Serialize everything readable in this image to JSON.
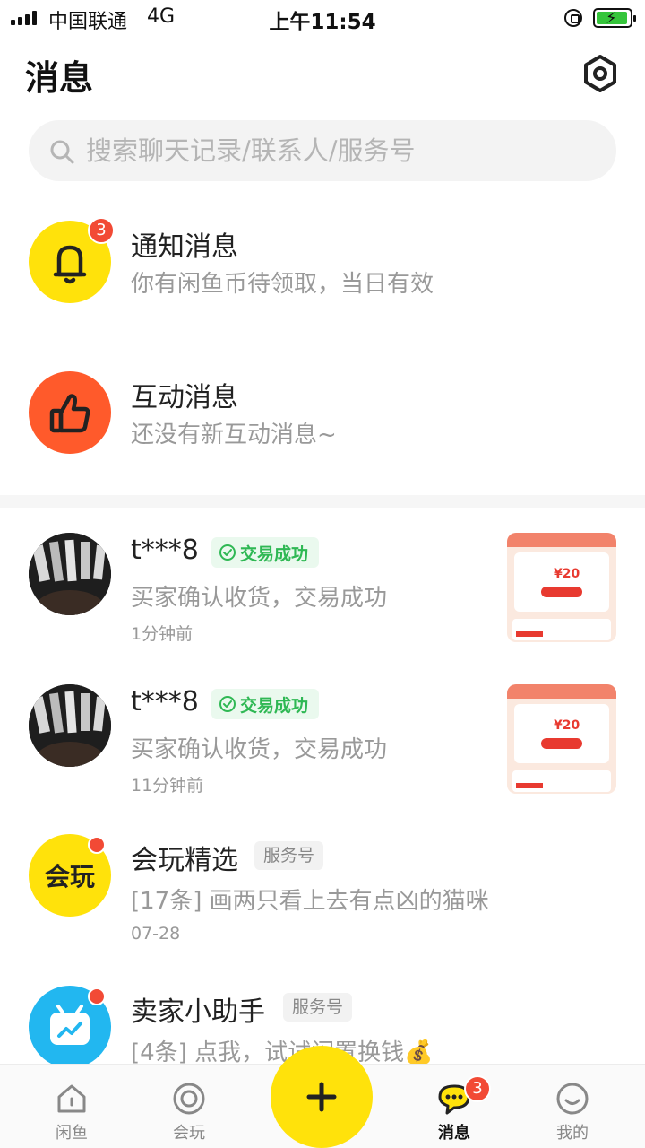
{
  "status_bar": {
    "carrier": "中国联通",
    "network": "4G",
    "time": "上午11:54",
    "battery_icon": "battery-charging-icon"
  },
  "header": {
    "title": "消息",
    "settings_icon": "settings-hexagon-icon"
  },
  "search": {
    "placeholder": "搜索聊天记录/联系人/服务号"
  },
  "system_rows": [
    {
      "title": "通知消息",
      "subtitle": "你有闲鱼币待领取，当日有效",
      "badge": "3",
      "icon": "bell-icon",
      "color": "#ffe20b"
    },
    {
      "title": "互动消息",
      "subtitle": "还没有新互动消息~",
      "icon": "thumbs-up-icon",
      "color": "#ff5a2b"
    }
  ],
  "conversations": [
    {
      "name": "t***8",
      "tag": "交易成功",
      "message": "买家确认收货，交易成功",
      "time": "1分钟前",
      "thumb_price": "¥20"
    },
    {
      "name": "t***8",
      "tag": "交易成功",
      "message": "买家确认收货，交易成功",
      "time": "11分钟前",
      "thumb_price": "¥20"
    },
    {
      "name": "会玩精选",
      "tag": "服务号",
      "message": "[17条] 画两只看上去有点凶的猫咪",
      "time": "07-28",
      "avatar_text": "会玩"
    },
    {
      "name": "卖家小助手",
      "tag": "服务号",
      "message": "[4条] 点我，试试闲置换钱💰"
    }
  ],
  "tabbar": {
    "tabs": [
      {
        "label": "闲鱼",
        "icon": "home-icon"
      },
      {
        "label": "会玩",
        "icon": "circle-icon"
      },
      {
        "label": "消息",
        "icon": "chat-icon",
        "badge": "3"
      },
      {
        "label": "我的",
        "icon": "smiley-icon"
      }
    ],
    "fab_icon": "plus-icon"
  },
  "colors": {
    "brand_yellow": "#ffe20b",
    "badge_red": "#f24a35",
    "success_green": "#2fb854"
  }
}
